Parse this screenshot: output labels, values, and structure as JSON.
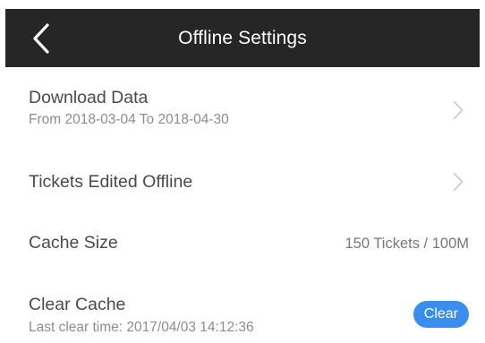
{
  "header": {
    "title": "Offline Settings",
    "back_icon": "chevron-left-icon"
  },
  "rows": {
    "download": {
      "title": "Download Data",
      "subtitle": "From 2018-03-04 To 2018-04-30",
      "icon": "chevron-right-icon"
    },
    "tickets_offline": {
      "title": "Tickets Edited Offline",
      "icon": "chevron-right-icon"
    },
    "cache_size": {
      "title": "Cache Size",
      "value": "150 Tickets / 100M"
    },
    "clear_cache": {
      "title": "Clear Cache",
      "subtitle": "Last clear time: 2017/04/03 14:12:36",
      "button_label": "Clear"
    }
  },
  "colors": {
    "header_bg": "#262626",
    "accent": "#3a8ef0"
  }
}
